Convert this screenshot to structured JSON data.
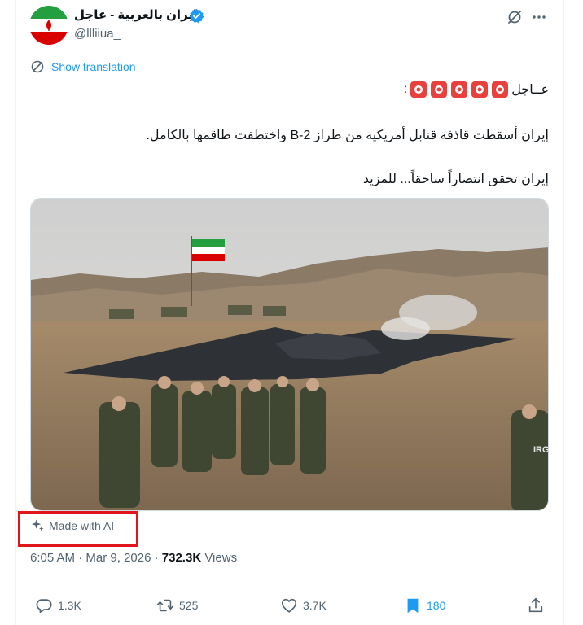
{
  "author": {
    "display_name": "إيران بالعربية - عاجل",
    "handle": "@llliiua_",
    "verified_icon": "verified-badge-icon"
  },
  "translate": {
    "label": "Show translation"
  },
  "tweet": {
    "line1": "عــاجل",
    "line1_suffix": ":",
    "line2": "إيران أسقطت قاذفة قنابل أمريكية من طراز B-2 واختطفت طاقمها بالكامل.",
    "line3": "إيران تحقق انتصاراً ساحقاً... للمزيد"
  },
  "media": {
    "ai_label": "Made with AI",
    "vehicle_marking": "IRG"
  },
  "meta": {
    "time": "6:05 AM",
    "sep": " · ",
    "date": "Mar 9, 2026",
    "views_count": "732.3K",
    "views_label": "Views"
  },
  "actions": {
    "replies": "1.3K",
    "reposts": "525",
    "likes": "3.7K",
    "bookmarks": "180"
  },
  "colors": {
    "accent": "#1d9bf0",
    "highlight_box": "#e0161c",
    "muted_text": "#536471"
  }
}
